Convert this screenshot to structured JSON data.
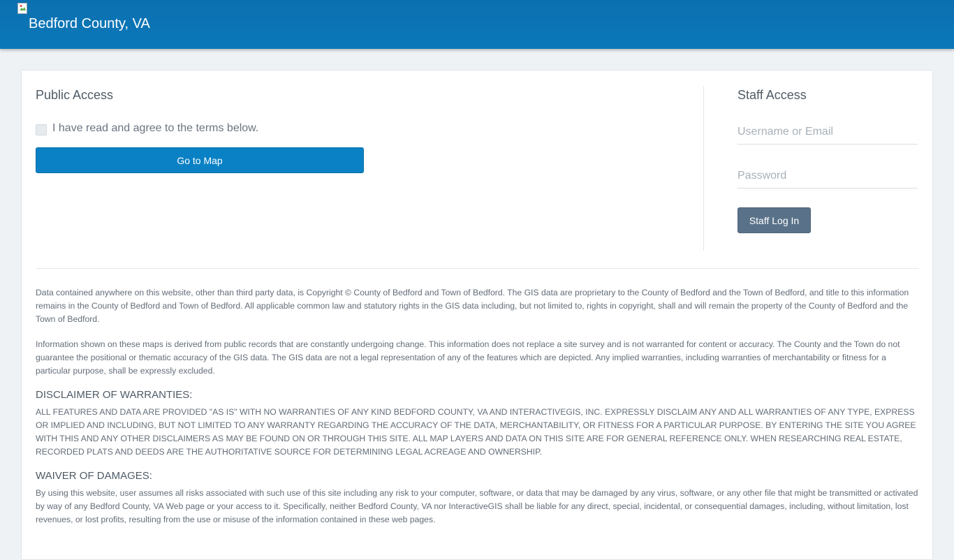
{
  "header": {
    "site_title": "Bedford County, VA"
  },
  "public_access": {
    "title": "Public Access",
    "agree_label": "I have read and agree to the terms below.",
    "agree_checked": false,
    "go_button": "Go to Map"
  },
  "staff_access": {
    "title": "Staff Access",
    "username_placeholder": "Username or Email",
    "username_value": "",
    "password_placeholder": "Password",
    "password_value": "",
    "login_button": "Staff Log In"
  },
  "terms": {
    "copyright": "Data contained anywhere on this website, other than third party data, is Copyright © County of Bedford and Town of Bedford. The GIS data are proprietary to the County of Bedford and the Town of Bedford, and title to this information remains in the County of Bedford and Town of Bedford. All applicable common law and statutory rights in the GIS data including, but not limited to, rights in copyright, shall and will remain the property of the County of Bedford and the Town of Bedford.",
    "information": "Information shown on these maps is derived from public records that are constantly undergoing change. This information does not replace a site survey and is not warranted for content or accuracy. The County and the Town do not guarantee the positional or thematic accuracy of the GIS data. The GIS data are not a legal representation of any of the features which are depicted. Any implied warranties, including warranties of merchantability or fitness for a particular purpose, shall be expressly excluded.",
    "disclaimer_heading": "DISCLAIMER OF WARRANTIES:",
    "disclaimer_lead": "ALL",
    "disclaimer_body": " FEATURES AND DATA ARE PROVIDED \"AS IS\" WITH NO WARRANTIES OF ANY KIND BEDFORD COUNTY, VA AND INTERACTIVEGIS, INC. EXPRESSLY DISCLAIM ANY AND ALL WARRANTIES OF ANY TYPE, EXPRESS OR IMPLIED AND INCLUDING, BUT NOT LIMITED TO ANY WARRANTY REGARDING THE ACCURACY OF THE DATA, MERCHANTABILITY, OR FITNESS FOR A PARTICULAR PURPOSE. BY ENTERING THE SITE YOU AGREE WITH THIS AND ANY OTHER DISCLAIMERS AS MAY BE FOUND ON OR THROUGH THIS SITE. ALL MAP LAYERS AND DATA ON THIS SITE ARE FOR GENERAL REFERENCE ONLY. WHEN RESEARCHING REAL ESTATE, RECORDED PLATS AND DEEDS ARE THE AUTHORITATIVE SOURCE FOR DETERMINING LEGAL ACREAGE AND OWNERSHIP.",
    "waiver_heading": "WAIVER OF DAMAGES:",
    "waiver_body": "By using this website, user assumes all risks associated with such use of this site including any risk to your computer, software, or data that may be damaged by any virus, software, or any other file that might be transmitted or activated by way of any Bedford County, VA Web page or your access to it. Specifically, neither Bedford County, VA nor InteractiveGIS shall be liable for any direct, special, incidental, or consequential damages, including, without limitation, lost revenues, or lost profits, resulting from the use or misuse of the information contained in these web pages."
  }
}
